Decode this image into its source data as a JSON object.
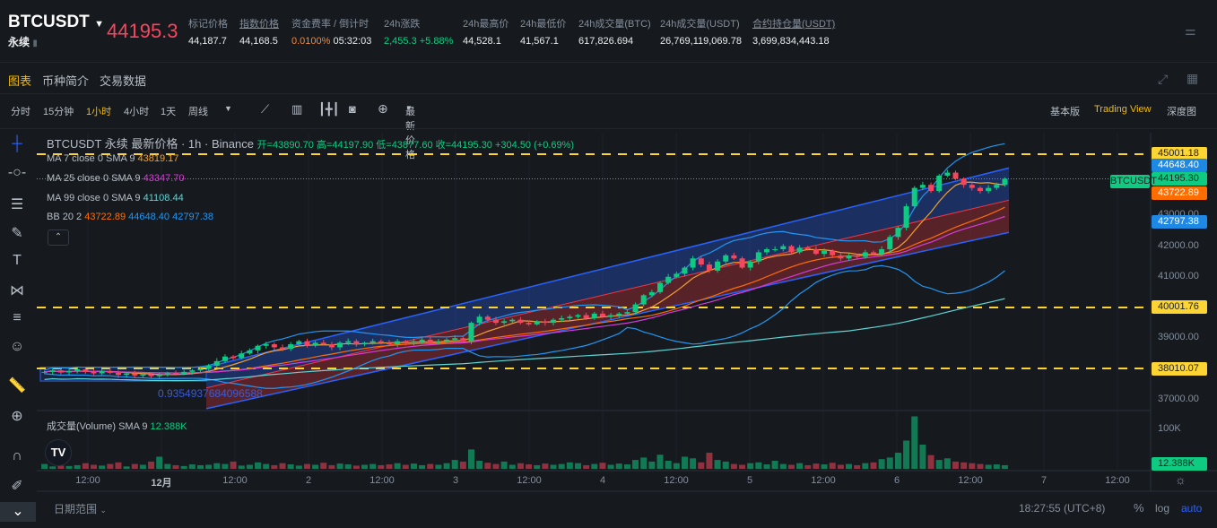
{
  "header": {
    "symbol": "BTCUSDT",
    "contract": "永续",
    "last_price": "44195.3",
    "stats": [
      {
        "label": "标记价格",
        "value": "44,187.7"
      },
      {
        "label": "指数价格",
        "value": "44,168.5"
      },
      {
        "label": "资金费率 / 倒计时",
        "value": "0.0100%",
        "value2": "05:32:03"
      },
      {
        "label": "24h涨跌",
        "value": "2,455.3 +5.88%"
      },
      {
        "label": "24h最高价",
        "value": "44,528.1"
      },
      {
        "label": "24h最低价",
        "value": "41,567.1"
      },
      {
        "label": "24h成交量(BTC)",
        "value": "617,826.694"
      },
      {
        "label": "24h成交量(USDT)",
        "value": "26,769,119,069.78"
      },
      {
        "label": "合约持仓量(USDT)",
        "value": "3,699,834,443.18"
      }
    ]
  },
  "tabs": [
    "图表",
    "币种简介",
    "交易数据"
  ],
  "toolbar": {
    "intervals": [
      "分时",
      "15分钟",
      "1小时",
      "4小时",
      "1天",
      "周线"
    ],
    "active_interval": "1小时",
    "price_type": "最新价格",
    "views": [
      "基本版",
      "Trading View",
      "深度图"
    ]
  },
  "legend": {
    "title": "BTCUSDT 永续 最新价格 · 1h · Binance",
    "ohlc": "开=43890.70 高=44197.90 低=43877.60 收=44195.30 +304.50 (+0.69%)",
    "ma7": {
      "label": "MA 7 close 0 SMA 9",
      "value": "43819.17"
    },
    "ma25": {
      "label": "MA 25 close 0 SMA 9",
      "value": "43347.70"
    },
    "ma99": {
      "label": "MA 99 close 0 SMA 9",
      "value": "41108.44"
    },
    "bb": {
      "label": "BB 20 2",
      "mid": "43722.89",
      "upper": "44648.40",
      "lower": "42797.38"
    },
    "volume": {
      "label": "成交量(Volume) SMA 9",
      "value": "12.388K"
    }
  },
  "channel_label": "0.9354937684096588",
  "price_labels": [
    {
      "text": "45001.18",
      "price": 45001.18,
      "bg": "#fcd535",
      "fg": "#1e2026"
    },
    {
      "text": "44648.40",
      "price": 44648.4,
      "bg": "#1e88e5",
      "fg": "#fff"
    },
    {
      "text": "44195.30",
      "price": 44195.3,
      "bg": "#0ecb81",
      "fg": "#1e2026"
    },
    {
      "text": "43722.89",
      "price": 43722.89,
      "bg": "#ff6d00",
      "fg": "#fff"
    },
    {
      "text": "42797.38",
      "price": 42797.38,
      "bg": "#1e88e5",
      "fg": "#fff"
    },
    {
      "text": "40001.76",
      "price": 40001.76,
      "bg": "#fcd535",
      "fg": "#1e2026"
    },
    {
      "text": "38010.07",
      "price": 38010.07,
      "bg": "#fcd535",
      "fg": "#1e2026"
    }
  ],
  "symbol_tag": "BTCUSDT",
  "axis_ticks": [
    "43000.00",
    "42000.00",
    "41000.00",
    "39000.00",
    "37000.00"
  ],
  "volume_axis": {
    "tick": "100K",
    "last": "12.388K"
  },
  "time_labels": [
    "12:00",
    "12月",
    "12:00",
    "2",
    "12:00",
    "3",
    "12:00",
    "4",
    "12:00",
    "5",
    "12:00",
    "6",
    "12:00",
    "7",
    "12:00"
  ],
  "bottom": {
    "date_range": "日期范围",
    "clock": "18:27:55 (UTC+8)",
    "pct": "%",
    "log": "log",
    "auto": "auto"
  },
  "colors": {
    "up": "#0ecb81",
    "down": "#f6465d",
    "accent": "#f0b90b"
  },
  "chart_data": {
    "type": "candlestick",
    "hlines": [
      45001.18,
      40001.76,
      38010.07
    ],
    "channel": {
      "upper": [
        38050,
        44550
      ],
      "lower": [
        36700,
        42450
      ]
    },
    "closes": [
      37900,
      37950,
      37880,
      37920,
      37980,
      37900,
      37850,
      37930,
      37870,
      37800,
      37850,
      37780,
      37820,
      37760,
      37800,
      37850,
      37830,
      37900,
      37950,
      38000,
      38100,
      38250,
      38400,
      38350,
      38500,
      38600,
      38750,
      38800,
      38700,
      38650,
      38800,
      38900,
      38750,
      38850,
      38800,
      38700,
      38850,
      38900,
      38800,
      38850,
      38900,
      38850,
      38800,
      38900,
      38850,
      38900,
      38950,
      38850,
      38900,
      38950,
      39000,
      38900,
      39500,
      39700,
      39600,
      39500,
      39550,
      39600,
      39500,
      39450,
      39550,
      39500,
      39600,
      39650,
      39700,
      39750,
      39650,
      39800,
      39700,
      39750,
      39800,
      39850,
      40100,
      40400,
      40500,
      40800,
      41000,
      41100,
      41300,
      41600,
      41400,
      41200,
      41500,
      41700,
      41600,
      41300,
      41500,
      41800,
      41900,
      41900,
      42000,
      41800,
      41950,
      41900,
      41750,
      41850,
      41700,
      41600,
      41700,
      41650,
      41800,
      41750,
      41900,
      42300,
      42600,
      43300,
      43900,
      44000,
      43800,
      44300,
      44400,
      44200,
      44000,
      43900,
      43800,
      43900,
      44000,
      44195.3
    ],
    "volumes_k": [
      12,
      6,
      8,
      7,
      9,
      14,
      10,
      8,
      12,
      16,
      6,
      12,
      10,
      18,
      30,
      12,
      9,
      7,
      11,
      9,
      10,
      14,
      12,
      18,
      8,
      10,
      16,
      12,
      9,
      14,
      11,
      8,
      12,
      10,
      15,
      9,
      13,
      11,
      8,
      10,
      12,
      9,
      11,
      14,
      10,
      13,
      9,
      12,
      10,
      14,
      22,
      18,
      48,
      20,
      15,
      12,
      18,
      10,
      14,
      11,
      9,
      13,
      10,
      12,
      16,
      14,
      9,
      12,
      15,
      10,
      13,
      11,
      22,
      28,
      18,
      35,
      20,
      14,
      30,
      26,
      16,
      40,
      22,
      18,
      12,
      10,
      14,
      16,
      11,
      20,
      12,
      10,
      14,
      9,
      13,
      11,
      15,
      10,
      12,
      9,
      14,
      16,
      24,
      28,
      40,
      70,
      130,
      60,
      34,
      22,
      26,
      18,
      16,
      14,
      12,
      10,
      11,
      9
    ]
  }
}
